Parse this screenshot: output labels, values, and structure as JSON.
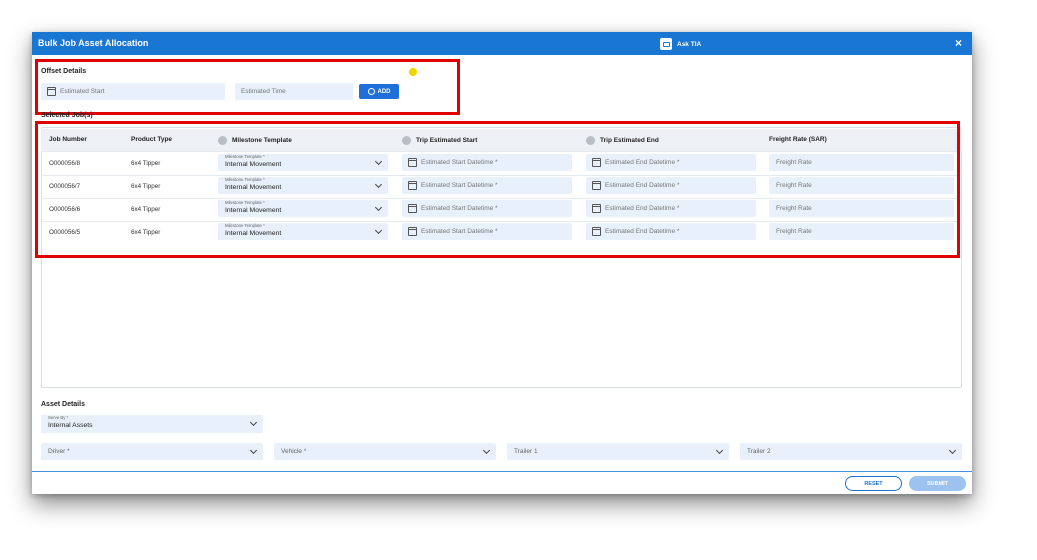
{
  "dialog": {
    "title": "Bulk Job Asset Allocation",
    "ask_label": "Ask TIA",
    "close_symbol": "×"
  },
  "offset": {
    "title": "Offset Details",
    "estimated_start_placeholder": "Estimated Start",
    "estimated_time_placeholder": "Estimated Time",
    "add_label": "ADD"
  },
  "jobs": {
    "title": "Selected Job(s)",
    "headers": [
      "Job Number",
      "Product Type",
      "Milestone Template",
      "Trip Estimated Start",
      "Trip Estimated End",
      "Freight Rate (SAR)"
    ],
    "rows": [
      {
        "job": "O000056/8",
        "product": "6x4 Tipper",
        "milestone_label": "Milestone Template *",
        "milestone": "Internal Movement",
        "start": "Estimated Start Datetime *",
        "end": "Estimated End Datetime *",
        "rate": "Freight Rate"
      },
      {
        "job": "O000056/7",
        "product": "6x4 Tipper",
        "milestone_label": "Milestone Template *",
        "milestone": "Internal Movement",
        "start": "Estimated Start Datetime *",
        "end": "Estimated End Datetime *",
        "rate": "Freight Rate"
      },
      {
        "job": "O000056/6",
        "product": "6x4 Tipper",
        "milestone_label": "Milestone Template *",
        "milestone": "Internal Movement",
        "start": "Estimated Start Datetime *",
        "end": "Estimated End Datetime *",
        "rate": "Freight Rate"
      },
      {
        "job": "O000056/5",
        "product": "6x4 Tipper",
        "milestone_label": "Milestone Template *",
        "milestone": "Internal Movement",
        "start": "Estimated Start Datetime *",
        "end": "Estimated End Datetime *",
        "rate": "Freight Rate"
      }
    ]
  },
  "asset": {
    "title": "Asset Details",
    "serve_by_label": "Serve By *",
    "serve_by_value": "Internal Assets",
    "driver": "Driver *",
    "vehicle": "Vehicle *",
    "trailer1": "Trailer 1",
    "trailer2": "Trailer 2"
  },
  "footer": {
    "reset": "RESET",
    "submit": "SUBMIT"
  },
  "colors": {
    "header_blue": "#1976d2",
    "field_bg": "#e8f0fb",
    "highlight_red": "#e00000"
  }
}
